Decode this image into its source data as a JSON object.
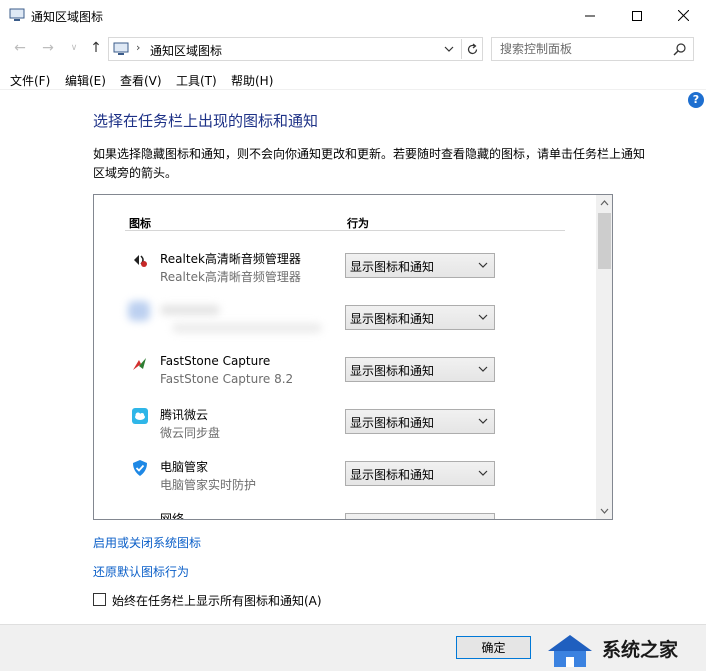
{
  "window": {
    "title": "通知区域图标"
  },
  "address": {
    "crumb": "通知区域图标",
    "search_placeholder": "搜索控制面板"
  },
  "menu": [
    "文件(F)",
    "编辑(E)",
    "查看(V)",
    "工具(T)",
    "帮助(H)"
  ],
  "main": {
    "heading": "选择在任务栏上出现的图标和通知",
    "description": "如果选择隐藏图标和通知，则不会向你通知更改和更新。若要随时查看隐藏的图标，请单击任务栏上通知区域旁的箭头。"
  },
  "list": {
    "col_icons": "图标",
    "col_behavior": "行为",
    "rows": [
      {
        "name": "Realtek高清晰音频管理器",
        "sub": "Realtek高清晰音频管理器",
        "behavior": "显示图标和通知",
        "icon": "speaker-icon"
      },
      {
        "name": "",
        "sub": "",
        "behavior": "显示图标和通知",
        "icon": "blurred-app-icon"
      },
      {
        "name": "FastStone Capture",
        "sub": "FastStone Capture 8.2",
        "behavior": "显示图标和通知",
        "icon": "faststone-capture-icon"
      },
      {
        "name": "腾讯微云",
        "sub": "微云同步盘",
        "behavior": "显示图标和通知",
        "icon": "weiyun-cloud-icon"
      },
      {
        "name": "电脑管家",
        "sub": "电脑管家实时防护",
        "behavior": "显示图标和通知",
        "icon": "pc-manager-shield-icon"
      },
      {
        "name": "网络",
        "sub": "",
        "behavior": "",
        "icon": "network-icon"
      }
    ]
  },
  "links": {
    "system_icons": "启用或关闭系统图标",
    "restore_default": "还原默认图标行为"
  },
  "checkbox": {
    "label": "始终在任务栏上显示所有图标和通知(A)",
    "checked": false
  },
  "footer": {
    "ok": "确定",
    "watermark": "系统之家"
  },
  "colors": {
    "heading": "#1e3287",
    "link": "#0b5fc8",
    "accent": "#0078d7"
  }
}
